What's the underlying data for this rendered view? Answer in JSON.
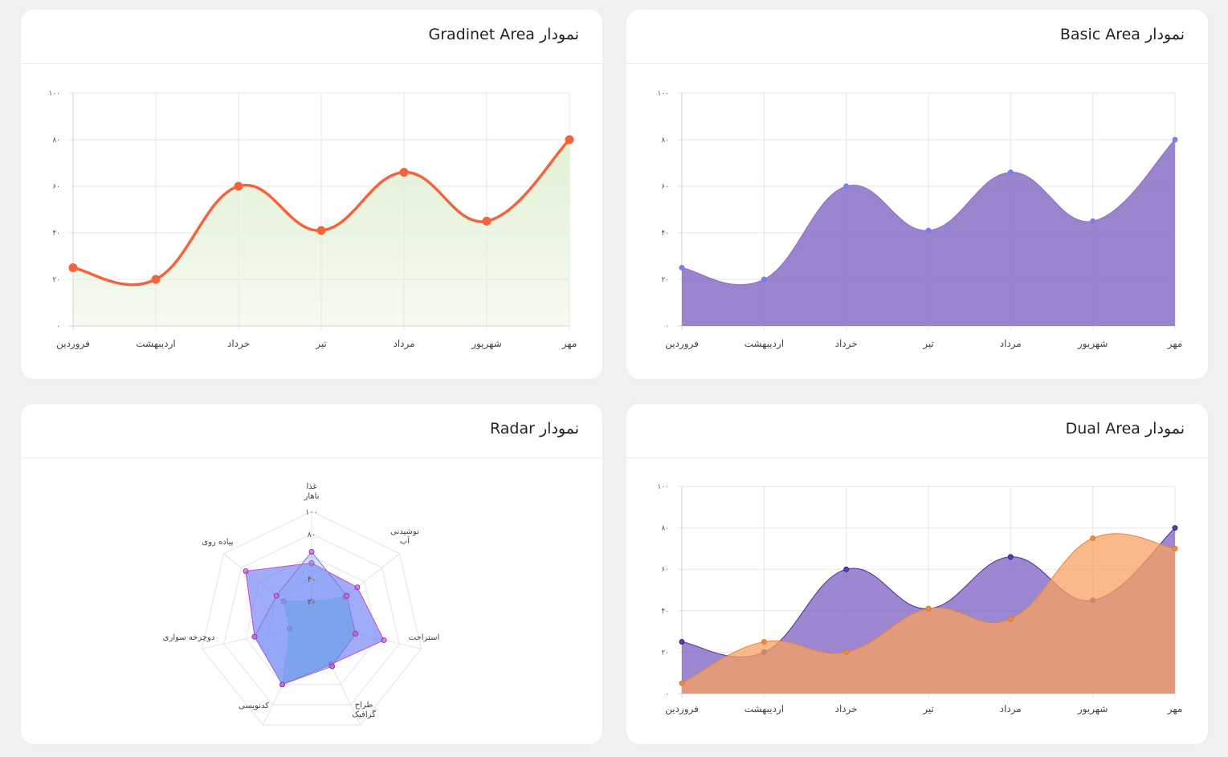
{
  "cards": {
    "gradient": {
      "title": "نمودار Gradinet Area"
    },
    "basic": {
      "title": "نمودار Basic Area"
    },
    "radar": {
      "title": "نمودار Radar"
    },
    "dual": {
      "title": "نمودار Dual Area"
    }
  },
  "colors": {
    "gradient_line": "#f2643d",
    "gradient_fill": "#e3f1d6",
    "basic_fill": "#8a6fc6",
    "basic_point": "#7a7ff0",
    "dual_purple": "#7b5fc0",
    "dual_orange": "#f9a060",
    "radar_teal": "#7fe8cf",
    "radar_blue": "#6f7ff5",
    "radar_pink": "#d040d0"
  },
  "chart_data": [
    {
      "id": "gradient",
      "type": "area",
      "title": "نمودار Gradinet Area",
      "x": [
        "فروردین",
        "اردیبهشت",
        "خرداد",
        "تیر",
        "مرداد",
        "شهریور",
        "مهر"
      ],
      "series": [
        {
          "values": [
            25,
            20,
            60,
            41,
            66,
            45,
            80
          ]
        }
      ],
      "ylim": [
        0,
        100
      ],
      "yticks": [
        "۰",
        "۲۰",
        "۴۰",
        "۶۰",
        "۸۰",
        "۱۰۰"
      ],
      "grid": true
    },
    {
      "id": "basic",
      "type": "area",
      "title": "نمودار Basic Area",
      "x": [
        "فروردین",
        "اردیبهشت",
        "خرداد",
        "تیر",
        "مرداد",
        "شهریور",
        "مهر"
      ],
      "series": [
        {
          "values": [
            25,
            20,
            60,
            41,
            66,
            45,
            80
          ]
        }
      ],
      "ylim": [
        0,
        100
      ],
      "yticks": [
        "۰",
        "۲۰",
        "۴۰",
        "۶۰",
        "۸۰",
        "۱۰۰"
      ],
      "grid": true
    },
    {
      "id": "radar",
      "type": "radar",
      "title": "نمودار Radar",
      "axes": [
        [
          "غذا",
          "ناهار"
        ],
        [
          "نوشیدنی",
          "آب"
        ],
        [
          "استراحت"
        ],
        [
          "طراح",
          "گرافیک"
        ],
        [
          "کدنویسی"
        ],
        [
          "دوچرخه سواری"
        ],
        [
          "پیاده روی"
        ]
      ],
      "ticks": [
        "۲۰",
        "۴۰",
        "۸۰",
        "۱۰۰"
      ],
      "rmax": 100,
      "series": [
        {
          "values": [
            20,
            38,
            40,
            42,
            60,
            20,
            32
          ],
          "color": "teal"
        },
        {
          "values": [
            54,
            52,
            66,
            40,
            60,
            52,
            75
          ],
          "color": "blue"
        },
        {
          "values": [
            64,
            40,
            40,
            42,
            60,
            52,
            40
          ],
          "color": "pink"
        }
      ],
      "grid": true
    },
    {
      "id": "dual",
      "type": "area",
      "title": "نمودار Dual Area",
      "x": [
        "فروردین",
        "اردیبهشت",
        "خرداد",
        "تیر",
        "مرداد",
        "شهریور",
        "مهر"
      ],
      "series": [
        {
          "values": [
            25,
            20,
            60,
            41,
            66,
            45,
            80
          ],
          "color": "purple"
        },
        {
          "values": [
            5,
            25,
            20,
            41,
            36,
            75,
            70
          ],
          "color": "orange"
        }
      ],
      "ylim": [
        0,
        100
      ],
      "yticks": [
        "۰",
        "۲۰",
        "۴۰",
        "۶۰",
        "۸۰",
        "۱۰۰"
      ],
      "grid": true
    }
  ]
}
